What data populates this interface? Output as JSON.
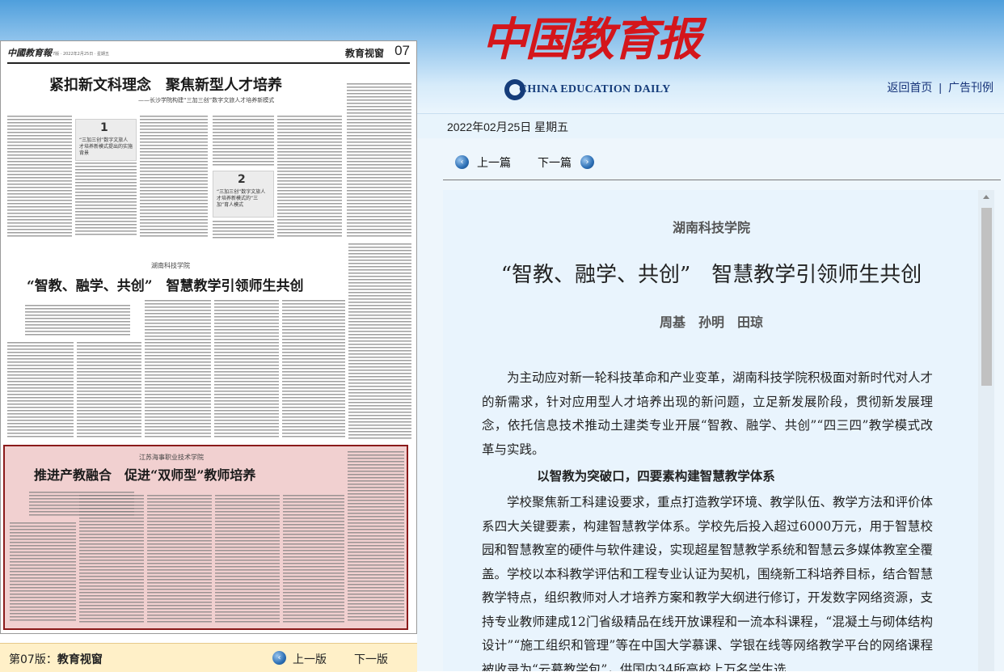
{
  "header": {
    "logo_cn": "中国教育报",
    "logo_en": "CHINA EDUCATION DAILY",
    "links": [
      "返回首页",
      "广告刊例"
    ],
    "link_separator": "|"
  },
  "date": "2022年02月25日 星期五",
  "newspaper": {
    "masthead": "中國教育報",
    "meta": "7版 · 2022年2月25日 · 星期五",
    "section": "教育视窗",
    "page_number": "07",
    "story1": {
      "title": "紧扣新文科理念　聚焦新型人才培养",
      "subtitle": "——长沙学院构建“三加三创”数字文旅人才培养新模式",
      "callout1_num": "1",
      "callout1_text": "“三加三创”数字文旅人才培养新模式提出的实施背景",
      "callout2_num": "2",
      "callout2_text": "“三加三创”数字文旅人才培养新模式的“三加”育人模式"
    },
    "story2": {
      "org": "湖南科技学院",
      "title": "“智教、融学、共创”　智慧教学引领师生共创"
    },
    "story3": {
      "org": "江苏海事职业技术学院",
      "title": "推进产教融合　促进“双师型”教师培养"
    },
    "footer": {
      "edition_label": "第07版：",
      "edition_name": "教育视窗",
      "prev": "上一版",
      "next": "下一版"
    }
  },
  "article_nav": {
    "prev": "上一篇",
    "next": "下一篇"
  },
  "article": {
    "org": "湖南科技学院",
    "title": "“智教、融学、共创”　智慧教学引领师生共创",
    "authors": "周基　孙明　田琼",
    "para1": "为主动应对新一轮科技革命和产业变革，湖南科技学院积极面对新时代对人才的新需求，针对应用型人才培养出现的新问题，立足新发展阶段，贯彻新发展理念，依托信息技术推动土建类专业开展“智教、融学、共创”“四三四”教学模式改革与实践。",
    "heading1": "以智教为突破口，四要素构建智慧教学体系",
    "para2": "学校聚焦新工科建设要求，重点打造教学环境、教学队伍、教学方法和评价体系四大关键要素，构建智慧教学体系。学校先后投入超过6000万元，用于智慧校园和智慧教室的硬件与软件建设，实现超星智慧教学系统和智慧云多媒体教室全覆盖。学校以本科教学评估和工程专业认证为契机，围绕新工科培养目标，结合智慧教学特点，组织教师对人才培养方案和教学大纲进行修订，开发数字网络资源，支持专业教师建成12门省级精品在线开放课程和一流本科课程，“混凝土与砌体结构设计”“施工组织和管理”等在中国大学慕课、学银在线等网络教学平台的网络课程被收录为“云慕教学包”，供国内34所高校上万名学生选"
  },
  "colors": {
    "logo_red": "#d4161b",
    "link_blue": "#17347a",
    "highlight_border": "#8b1a1a",
    "footer_bg": "#fff0c8",
    "article_bg": "#e9f4fd"
  },
  "icons": [
    "prev-arrow-icon",
    "next-arrow-icon"
  ]
}
